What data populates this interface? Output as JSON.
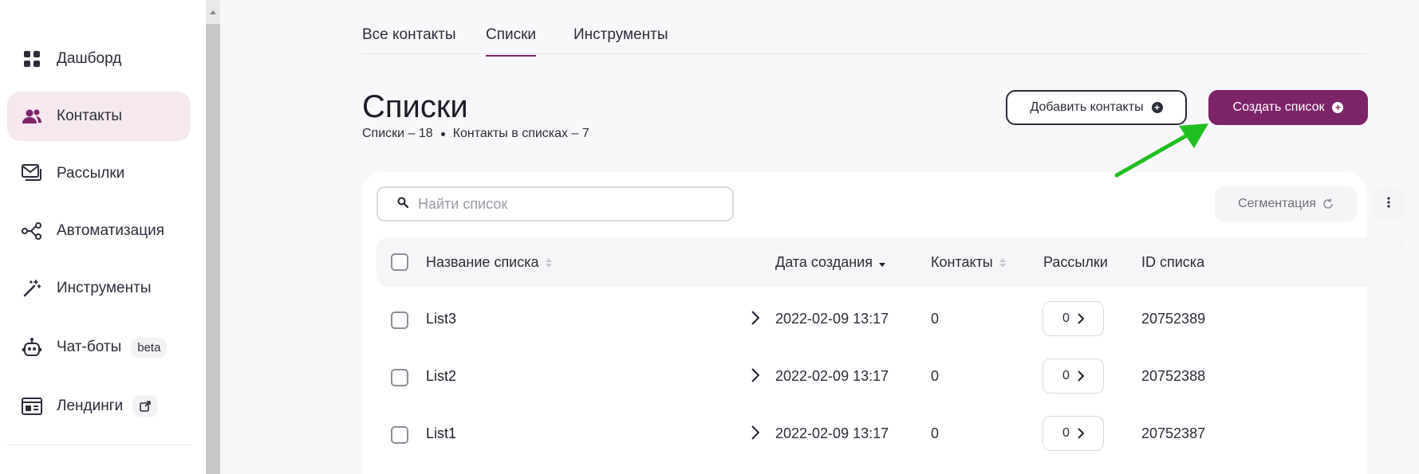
{
  "sidebar": {
    "items": [
      {
        "label": "Дашборд",
        "icon": "dashboard-icon"
      },
      {
        "label": "Контакты",
        "icon": "contacts-icon",
        "active": true
      },
      {
        "label": "Рассылки",
        "icon": "mail-icon"
      },
      {
        "label": "Автоматизация",
        "icon": "automation-icon"
      },
      {
        "label": "Инструменты",
        "icon": "magic-wand-icon"
      },
      {
        "label": "Чат-боты",
        "icon": "robot-icon",
        "badge": "beta"
      },
      {
        "label": "Лендинги",
        "icon": "landing-icon",
        "external": true
      }
    ]
  },
  "tabs": [
    {
      "label": "Все контакты"
    },
    {
      "label": "Списки",
      "active": true
    },
    {
      "label": "Инструменты"
    }
  ],
  "page": {
    "title": "Списки",
    "lists_count": "Списки – 18",
    "contacts_count": "Контакты в списках – 7"
  },
  "actions": {
    "add_contacts": "Добавить контакты",
    "create_list": "Создать список"
  },
  "search": {
    "placeholder": "Найти список"
  },
  "segmentation": {
    "label": "Сегментация"
  },
  "table": {
    "headers": {
      "name": "Название списка",
      "created": "Дата создания",
      "contacts": "Контакты",
      "mailings": "Рассылки",
      "id": "ID списка"
    },
    "rows": [
      {
        "name": "List3",
        "created": "2022-02-09 13:17",
        "contacts": "0",
        "mailings": "0",
        "id": "20752389"
      },
      {
        "name": "List2",
        "created": "2022-02-09 13:17",
        "contacts": "0",
        "mailings": "0",
        "id": "20752388"
      },
      {
        "name": "List1",
        "created": "2022-02-09 13:17",
        "contacts": "0",
        "mailings": "0",
        "id": "20752387"
      }
    ]
  },
  "colors": {
    "accent": "#7d2468",
    "active_nav_bg": "#f5e8ef",
    "annotation_arrow": "#1fbf1f"
  }
}
